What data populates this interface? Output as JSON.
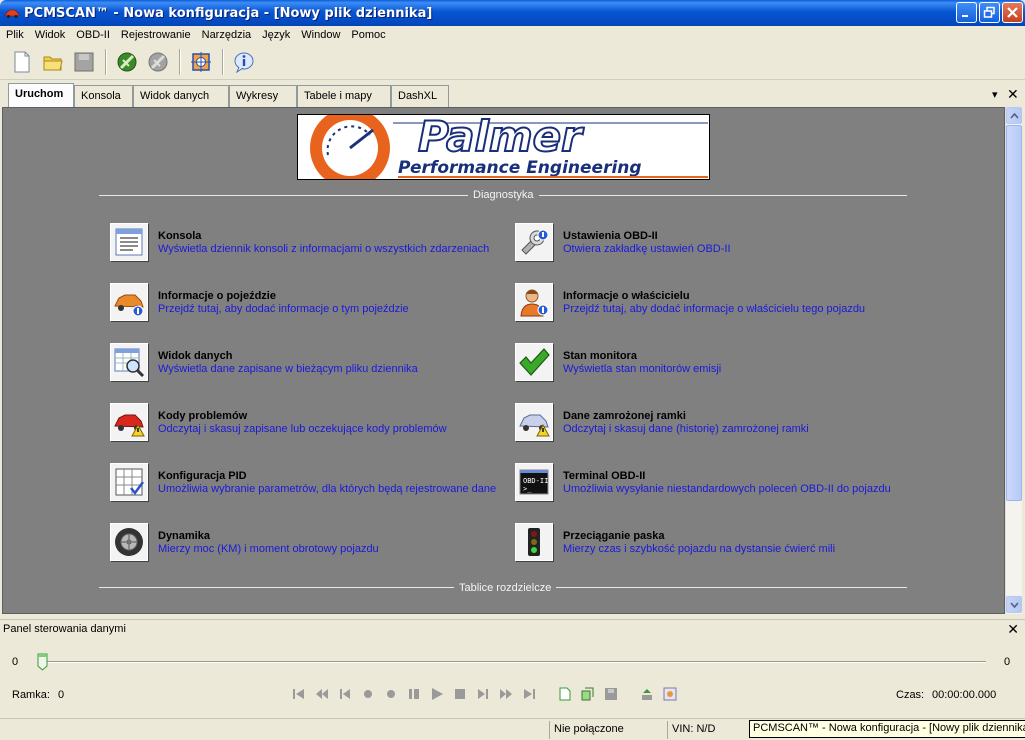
{
  "window": {
    "title": "PCMSCAN™ - Nowa konfiguracja - [Nowy plik dziennika]"
  },
  "menu": [
    "Plik",
    "Widok",
    "OBD-II",
    "Rejestrowanie",
    "Narzędzia",
    "Język",
    "Window",
    "Pomoc"
  ],
  "toolbar": {
    "buttons": [
      "new-file-icon",
      "open-folder-icon",
      "save-icon",
      "connect-icon",
      "disconnect-icon",
      "target-icon",
      "info-icon"
    ]
  },
  "tabs": [
    "Uruchom",
    "Konsola",
    "Widok danych",
    "Wykresy",
    "Tabele i mapy",
    "DashXL"
  ],
  "logo": {
    "brand": "Palmer",
    "tagline": "Performance Engineering"
  },
  "sections": {
    "diagnostics": "Diagnostyka",
    "dashboards": "Tablice rozdzielcze"
  },
  "entries_left": [
    {
      "title": "Konsola",
      "desc": "Wyświetla dziennik konsoli z informacjami o wszystkich zdarzeniach",
      "icon": "console-icon"
    },
    {
      "title": "Informacje o pojeździe",
      "desc": "Przejdź tutaj, aby dodać informacje o tym pojeździe",
      "icon": "vehicle-info-icon"
    },
    {
      "title": "Widok danych",
      "desc": "Wyświetla dane zapisane w bieżącym pliku dziennika",
      "icon": "data-view-icon"
    },
    {
      "title": "Kody problemów",
      "desc": "Odczytaj i skasuj zapisane lub oczekujące kody problemów",
      "icon": "trouble-codes-icon"
    },
    {
      "title": "Konfiguracja PID",
      "desc": "Umożliwia wybranie parametrów, dla których będą rejestrowane dane",
      "icon": "pid-config-icon"
    },
    {
      "title": "Dynamika",
      "desc": "Mierzy moc (KM) i moment obrotowy pojazdu",
      "icon": "dyno-wheel-icon"
    }
  ],
  "entries_right": [
    {
      "title": "Ustawienia OBD-II",
      "desc": "Otwiera zakładkę ustawień OBD-II",
      "icon": "obd-settings-icon"
    },
    {
      "title": "Informacje o właścicielu",
      "desc": "Przejdź tutaj, aby dodać informacje o właścicielu tego pojazdu",
      "icon": "owner-info-icon"
    },
    {
      "title": "Stan monitora",
      "desc": "Wyświetla stan monitorów emisji",
      "icon": "checkmark-icon"
    },
    {
      "title": "Dane zamrożonej ramki",
      "desc": "Odczytaj i skasuj dane (historię) zamrożonej ramki",
      "icon": "freeze-frame-icon"
    },
    {
      "title": "Terminal OBD-II",
      "desc": "Umożliwia wysyłanie niestandardowych poleceń OBD-II do pojazdu",
      "icon": "terminal-icon"
    },
    {
      "title": "Przeciąganie paska",
      "desc": "Mierzy czas i szybkość pojazdu na dystansie ćwierć mili",
      "icon": "traffic-light-icon"
    }
  ],
  "panel": {
    "title": "Panel sterowania danymi",
    "slider_min": "0",
    "slider_max": "0",
    "frame_label": "Ramka:",
    "frame_value": "0",
    "time_label": "Czas:",
    "time_value": "00:00:00.000"
  },
  "status": {
    "connection": "Nie połączone",
    "vin": "VIN: N/D"
  },
  "tooltip": "PCMSCAN™ - Nowa konfiguracja - [Nowy plik dziennika]"
}
